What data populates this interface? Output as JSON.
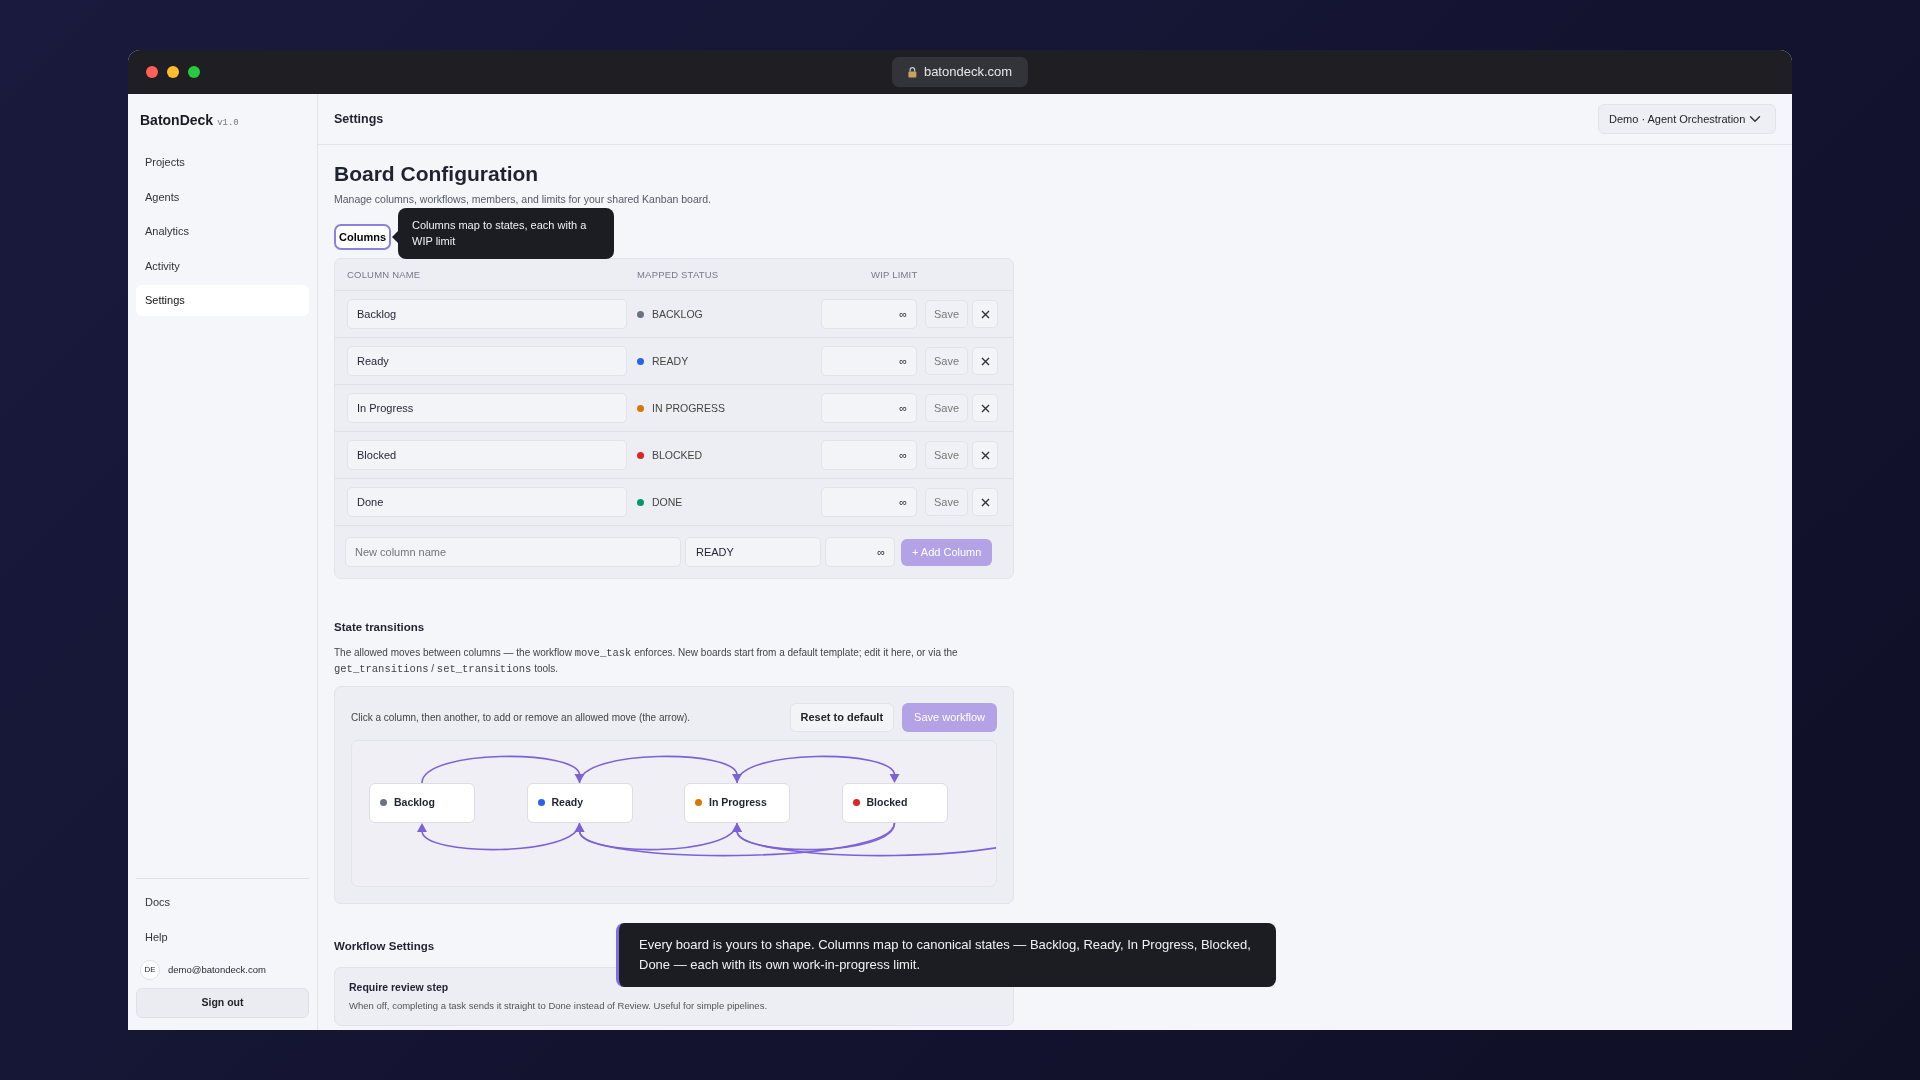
{
  "window": {
    "url": "batondeck.com"
  },
  "sidebar": {
    "brand": "BatonDeck",
    "version": "v1.0",
    "items": [
      {
        "label": "Projects",
        "selected": false
      },
      {
        "label": "Agents",
        "selected": false
      },
      {
        "label": "Analytics",
        "selected": false
      },
      {
        "label": "Activity",
        "selected": false
      },
      {
        "label": "Settings",
        "selected": true
      }
    ],
    "footer_links": [
      "Docs",
      "Help"
    ],
    "user": {
      "initials": "DE",
      "email": "demo@batondeck.com"
    },
    "sign_out": "Sign out"
  },
  "header": {
    "title": "Settings",
    "board_select": "Demo · Agent Orchestration"
  },
  "page": {
    "title": "Board Configuration",
    "subtitle": "Manage columns, workflows, members, and limits for your shared Kanban board."
  },
  "columns_section": {
    "tab": "Columns",
    "tooltip": "Columns map to states, each with a WIP limit",
    "headers": [
      "COLUMN NAME",
      "MAPPED STATUS",
      "WIP LIMIT"
    ],
    "rows": [
      {
        "name": "Backlog",
        "status": "BACKLOG",
        "color": "#6b7280",
        "wip": "∞",
        "save": "Save"
      },
      {
        "name": "Ready",
        "status": "READY",
        "color": "#2563eb",
        "wip": "∞",
        "save": "Save"
      },
      {
        "name": "In Progress",
        "status": "IN PROGRESS",
        "color": "#d97706",
        "wip": "∞",
        "save": "Save"
      },
      {
        "name": "Blocked",
        "status": "BLOCKED",
        "color": "#dc2626",
        "wip": "∞",
        "save": "Save"
      },
      {
        "name": "Done",
        "status": "DONE",
        "color": "#059669",
        "wip": "∞",
        "save": "Save"
      }
    ],
    "new_row": {
      "placeholder": "New column name",
      "status": "READY",
      "wip": "∞",
      "button": "+ Add Column"
    }
  },
  "transitions": {
    "title": "State transitions",
    "description": [
      {
        "kind": "text",
        "text": "The allowed moves between columns — the workflow "
      },
      {
        "kind": "code",
        "text": "move_task"
      },
      {
        "kind": "text",
        "text": " enforces. New boards start from a default template; edit it here, or via the "
      },
      {
        "kind": "code",
        "text": "get_transitions"
      },
      {
        "kind": "text",
        "text": " / "
      },
      {
        "kind": "code",
        "text": "set_transitions"
      },
      {
        "kind": "text",
        "text": " tools."
      }
    ],
    "hint": "Click a column, then another, to add or remove an allowed move (the arrow).",
    "reset": "Reset to default",
    "save": "Save workflow",
    "nodes": [
      {
        "label": "Backlog",
        "color": "#6b7280"
      },
      {
        "label": "Ready",
        "color": "#2563eb"
      },
      {
        "label": "In Progress",
        "color": "#d97706"
      },
      {
        "label": "Blocked",
        "color": "#dc2626"
      }
    ]
  },
  "workflow_settings": {
    "title": "Workflow Settings",
    "settings": [
      {
        "title": "Require review step",
        "description": "When off, completing a task sends it straight to Done instead of Review. Useful for simple pipelines."
      }
    ]
  },
  "tour_tooltip": "Every board is yours to shape. Columns map to canonical states — Backlog, Ready, In Progress, Blocked, Done — each with its own work-in-progress limit."
}
